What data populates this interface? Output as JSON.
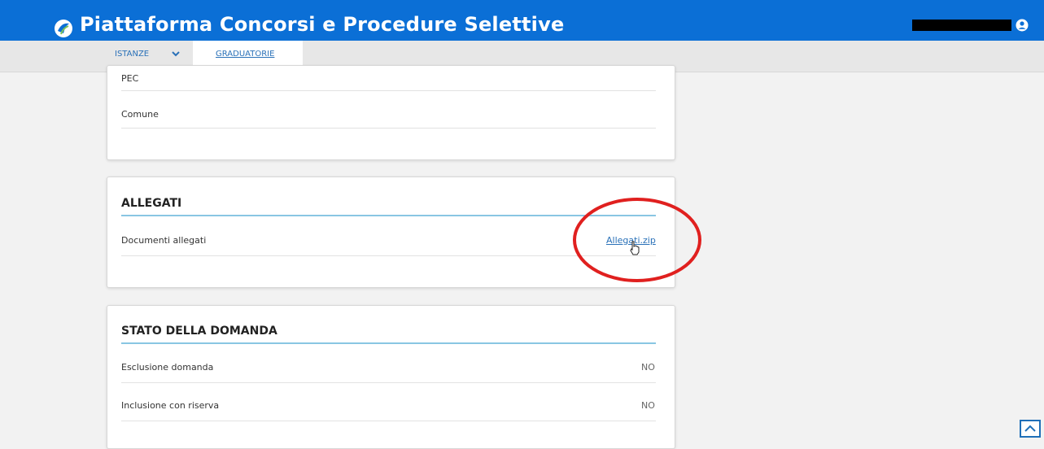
{
  "header": {
    "app_title": "Piattaforma Concorsi e Procedure Selettive",
    "logo_icon": "platform-logo-icon",
    "user_icon": "user-account-icon"
  },
  "nav": {
    "tabs": [
      {
        "label": "ISTANZE",
        "icon": "chevron-down-icon"
      },
      {
        "label": "GRADUATORIE"
      }
    ]
  },
  "card1": {
    "rows": [
      {
        "label": "PEC"
      },
      {
        "label": "Comune"
      }
    ]
  },
  "allegati": {
    "title": "ALLEGATI",
    "rows": [
      {
        "label": "Documenti allegati",
        "link": "Allegati.zip"
      }
    ]
  },
  "stato": {
    "title": "STATO DELLA DOMANDA",
    "rows": [
      {
        "label": "Esclusione domanda",
        "value": "NO"
      },
      {
        "label": "Inclusione con riserva",
        "value": "NO"
      }
    ]
  },
  "colors": {
    "header_bg": "#0b6fd6",
    "accent_rule": "#89c6e3",
    "link": "#2a71b8",
    "annotation": "#e0201f"
  },
  "scroll_top_icon": "chevron-up-icon"
}
